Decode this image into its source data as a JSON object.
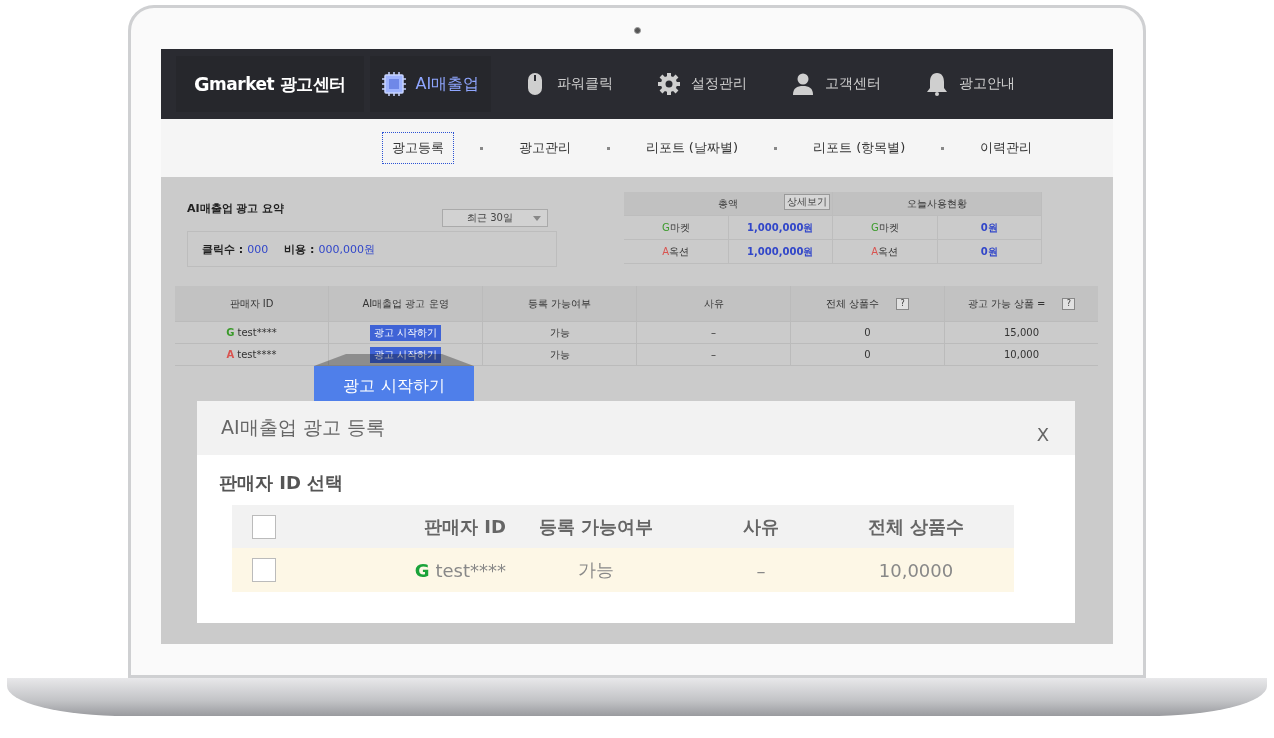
{
  "brand": {
    "mark": "G",
    "name": "market 광고센터"
  },
  "nav": [
    {
      "label": "AI매출업",
      "selected": true
    },
    {
      "label": "파워클릭",
      "selected": false
    },
    {
      "label": "설정관리",
      "selected": false
    },
    {
      "label": "고객센터",
      "selected": false
    },
    {
      "label": "광고안내",
      "selected": false
    }
  ],
  "subnav": [
    {
      "label": "광고등록",
      "selected": true
    },
    {
      "label": "광고관리",
      "selected": false
    },
    {
      "label": "리포트 (날짜별)",
      "selected": false
    },
    {
      "label": "리포트 (항목별)",
      "selected": false
    },
    {
      "label": "이력관리",
      "selected": false
    }
  ],
  "summary": {
    "title": "AI매출업 광고 요약",
    "period": "최근 30일",
    "clicks_label": "클릭수 :",
    "clicks": "000",
    "cost_label": "비용 :",
    "cost": "000,000원"
  },
  "totals": {
    "columns": [
      "총액",
      "오늘사용현황"
    ],
    "detail_button": "상세보기",
    "rows": [
      {
        "mark": "G",
        "market": "마켓",
        "color": "#3a9a2a",
        "total": "1,000,000원",
        "mark2": "G",
        "market2": "마켓",
        "today": "0원"
      },
      {
        "mark": "A",
        "market": "옥션",
        "color": "#d9534f",
        "total": "1,000,000원",
        "mark2": "A",
        "market2": "옥션",
        "today": "0원"
      }
    ]
  },
  "table": {
    "columns": [
      {
        "label": "판매자 ID",
        "help": false
      },
      {
        "label": "AI매출업 광고 운영",
        "help": false
      },
      {
        "label": "등록 가능여부",
        "help": false
      },
      {
        "label": "사유",
        "help": false
      },
      {
        "label": "전체 상품수",
        "help": true
      },
      {
        "label": "광고 가능 상품 =",
        "help": true
      }
    ],
    "help_mark": "?",
    "rows": [
      {
        "mark": "G",
        "color": "#3a9a2a",
        "id": "test****",
        "action": "광고 시작하기",
        "available": "가능",
        "reason": "–",
        "total": "0",
        "possible": "15,000"
      },
      {
        "mark": "A",
        "color": "#d9534f",
        "id": "test****",
        "action": "광고 시작하기",
        "available": "가능",
        "reason": "–",
        "total": "0",
        "possible": "10,000"
      }
    ]
  },
  "callout": {
    "label": "광고 시작하기"
  },
  "modal": {
    "title": "AI매출업 광고 등록",
    "close": "X",
    "section": "판매자 ID 선택",
    "columns": [
      "판매자 ID",
      "등록 가능여부",
      "사유",
      "전체 상품수"
    ],
    "header_checked": false,
    "rows": [
      {
        "checked": false,
        "mark": "G",
        "color": "#1aa33a",
        "id": "test****",
        "available": "가능",
        "reason": "–",
        "total": "10,0000"
      }
    ]
  }
}
